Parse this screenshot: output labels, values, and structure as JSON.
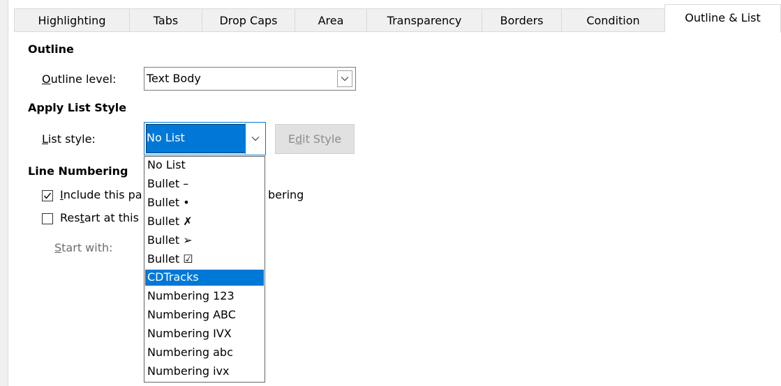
{
  "tabs": [
    {
      "label": "Highlighting",
      "active": false
    },
    {
      "label": "Tabs",
      "active": false
    },
    {
      "label": "Drop Caps",
      "active": false
    },
    {
      "label": "Area",
      "active": false
    },
    {
      "label": "Transparency",
      "active": false
    },
    {
      "label": "Borders",
      "active": false
    },
    {
      "label": "Condition",
      "active": false
    },
    {
      "label": "Outline & List",
      "active": true
    }
  ],
  "outline": {
    "heading": "Outline",
    "level_label_accel": "O",
    "level_label_rest": "utline level:",
    "level_value": "Text Body"
  },
  "list_style": {
    "heading": "Apply List Style",
    "label_accel": "L",
    "label_rest": "ist style:",
    "value": "No List",
    "edit_button_pre": "E",
    "edit_button_accel": "d",
    "edit_button_rest": "it Style",
    "options": [
      "No List",
      "Bullet –",
      "Bullet •",
      "Bullet ✗",
      "Bullet ➢",
      "Bullet ☑",
      "CDTracks",
      "Numbering 123",
      "Numbering ABC",
      "Numbering IVX",
      "Numbering abc",
      "Numbering ivx"
    ],
    "highlighted_option": "CDTracks"
  },
  "line_numbering": {
    "heading": "Line Numbering",
    "include_accel": "I",
    "include_visible_start": "nclude this pa",
    "include_visible_end": "bering",
    "include_checked": true,
    "restart_pre": "Res",
    "restart_accel": "t",
    "restart_visible": "art at this",
    "restart_checked": false,
    "start_with_accel": "S",
    "start_with_rest": "tart with:"
  },
  "colors": {
    "selection": "#0078d7",
    "disabled_text": "#8c8c8c"
  }
}
